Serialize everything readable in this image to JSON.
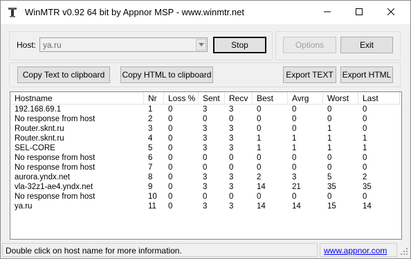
{
  "window": {
    "title": "WinMTR v0.92 64 bit by Appnor MSP - www.winmtr.net"
  },
  "host": {
    "label": "Host:",
    "value": "ya.ru"
  },
  "buttons": {
    "stop": "Stop",
    "options": "Options",
    "exit": "Exit",
    "copy_text": "Copy Text to clipboard",
    "copy_html": "Copy HTML to clipboard",
    "export_text": "Export TEXT",
    "export_html": "Export HTML"
  },
  "table": {
    "columns": [
      "Hostname",
      "Nr",
      "Loss %",
      "Sent",
      "Recv",
      "Best",
      "Avrg",
      "Worst",
      "Last"
    ],
    "rows": [
      [
        "192.168.69.1",
        "1",
        "0",
        "3",
        "3",
        "0",
        "0",
        "0",
        "0"
      ],
      [
        "No response from host",
        "2",
        "0",
        "0",
        "0",
        "0",
        "0",
        "0",
        "0"
      ],
      [
        "Router.sknt.ru",
        "3",
        "0",
        "3",
        "3",
        "0",
        "0",
        "1",
        "0"
      ],
      [
        "Router.sknt.ru",
        "4",
        "0",
        "3",
        "3",
        "1",
        "1",
        "1",
        "1"
      ],
      [
        "SEL-CORE",
        "5",
        "0",
        "3",
        "3",
        "1",
        "1",
        "1",
        "1"
      ],
      [
        "No response from host",
        "6",
        "0",
        "0",
        "0",
        "0",
        "0",
        "0",
        "0"
      ],
      [
        "No response from host",
        "7",
        "0",
        "0",
        "0",
        "0",
        "0",
        "0",
        "0"
      ],
      [
        "aurora.yndx.net",
        "8",
        "0",
        "3",
        "3",
        "2",
        "3",
        "5",
        "2"
      ],
      [
        "vla-32z1-ae4.yndx.net",
        "9",
        "0",
        "3",
        "3",
        "14",
        "21",
        "35",
        "35"
      ],
      [
        "No response from host",
        "10",
        "0",
        "0",
        "0",
        "0",
        "0",
        "0",
        "0"
      ],
      [
        "ya.ru",
        "11",
        "0",
        "3",
        "3",
        "14",
        "14",
        "15",
        "14"
      ]
    ]
  },
  "status": {
    "message": "Double click on host name for more information.",
    "link": "www.appnor.com"
  },
  "icons": {
    "app": "app-icon",
    "minimize": "minimize-icon",
    "maximize": "maximize-icon",
    "close": "close-icon",
    "dropdown": "chevron-down-icon",
    "grip": "resize-grip-icon"
  }
}
